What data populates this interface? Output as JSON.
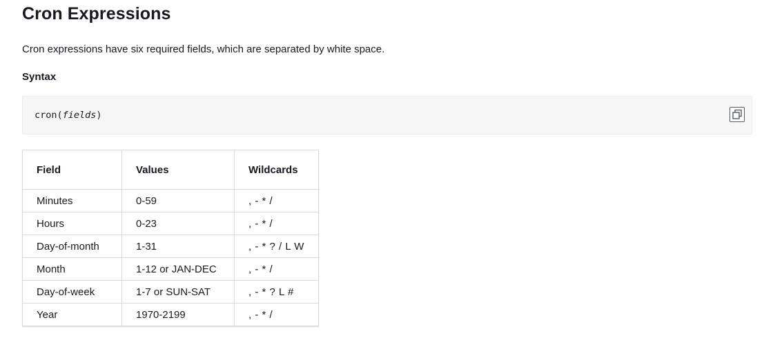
{
  "title": "Cron Expressions",
  "intro": "Cron expressions have six required fields, which are separated by white space.",
  "syntax_heading": "Syntax",
  "code": {
    "prefix": "cron(",
    "arg": "fields",
    "suffix": ")",
    "copy_icon": "copy-icon"
  },
  "table": {
    "headers": [
      "Field",
      "Values",
      "Wildcards"
    ],
    "rows": [
      {
        "field": "Minutes",
        "values": "0-59",
        "wildcards": ", - * /"
      },
      {
        "field": "Hours",
        "values": "0-23",
        "wildcards": ", - * /"
      },
      {
        "field": "Day-of-month",
        "values": "1-31",
        "wildcards": ", - * ? / L W"
      },
      {
        "field": "Month",
        "values": "1-12 or JAN-DEC",
        "wildcards": ", - * /"
      },
      {
        "field": "Day-of-week",
        "values": "1-7 or SUN-SAT",
        "wildcards": ", - * ? L #"
      },
      {
        "field": "Year",
        "values": "1970-2199",
        "wildcards": ", - * /"
      }
    ]
  }
}
